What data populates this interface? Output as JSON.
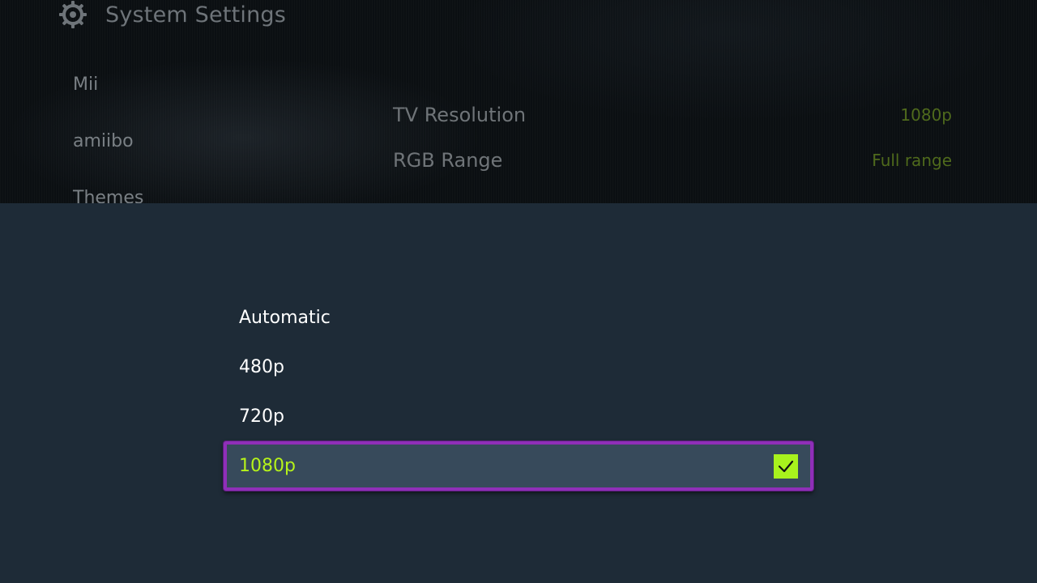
{
  "header": {
    "title": "System Settings",
    "icon": "gear-icon"
  },
  "sidebar": {
    "items": [
      {
        "label": "Mii"
      },
      {
        "label": "amiibo"
      },
      {
        "label": "Themes"
      }
    ]
  },
  "settings": {
    "rows": [
      {
        "label": "TV Resolution",
        "value": "1080p"
      },
      {
        "label": "RGB Range",
        "value": "Full range"
      }
    ]
  },
  "popup": {
    "options": [
      {
        "label": "Automatic"
      },
      {
        "label": "480p"
      },
      {
        "label": "720p"
      },
      {
        "label": "1080p"
      }
    ],
    "selected_index": 3,
    "selected_icon": "checkmark-icon"
  },
  "colors": {
    "popup_background": "#1e2b37",
    "selected_text": "#b6f31a",
    "selected_border": "#8f2fb8",
    "checkbox_fill": "#a8f21d",
    "value_text": "#4f6a1c"
  }
}
